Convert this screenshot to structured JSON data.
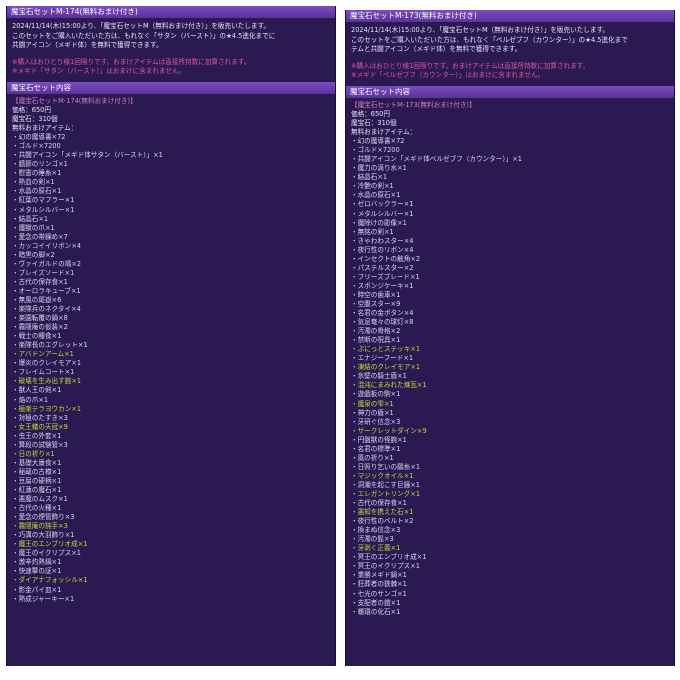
{
  "left": {
    "header1": "魔宝石セットM-174(無料おまけ付き)",
    "notice": [
      "2024/11/14(木)15:00より、「魔宝石セットM（無料おまけ付き）」を販売いたします。",
      "このセットをご購入いただいた方は、もれなく「サタン（バースト）」の★4.5進化までに",
      "共闘アイコン（メギド体）を無料で獲得できます。"
    ],
    "warnings": [
      "※購入はおひとり様1回限りです。おまけアイテムは直接所持数に加算されます。",
      "※メギド「サタン（バースト）」はおまけに含まれません。"
    ],
    "header2": "魔宝石セット内容",
    "set_title": "【魔宝石セットM-174(無料おまけ付き)】",
    "price": "価格：650円",
    "gems": "魔宝石：310個",
    "bonus_label": "無料おまけアイテム：",
    "items": [
      "幻の魔導書×72",
      "ゴルド×7200",
      "共闘アイコン「メギド体サタン（バースト）」×1",
      "膳節のリンゴ×1",
      "慰霊の睡糸×1",
      "熱血の剣×1",
      "水晶の原石×1",
      "紅葉のマフラー×1",
      "メタルシルバー×1",
      "結晶石×1",
      "魔獣の爪×1",
      "愛念の帯錦め×7",
      "カッコイイリボン×4",
      "暗黒の脚×2",
      "ヴァイガルドの鳩×2",
      "ブレイズソード×1",
      "古代の保存食×1",
      "オーロラキューブ×1",
      "無風の尾嶽×6",
      "楽隊兵のネクタイ×4",
      "楽園転覆の鍋×8",
      "霧隠庵の仮装×2",
      "戦士の種食×1",
      "楽隊長のエグレット×1",
      "アバドンアーム×1",
      "爆炎のクレイモア×1",
      "フレイムコート×1",
      "破壊を生み出す腕×1",
      "獣人王の剣×1",
      "焔の爪×1",
      "極楽テラヨウカン×1",
      "対極のたすき×3",
      "女王蟻の天冠×9",
      "虫王の外套×1",
      "算段の試験管×3",
      "日の祈り×1",
      "基礎大康食×1",
      "秘蔵の古樽×1",
      "豆腐の硬柄×1",
      "紅蓮の魔石×1",
      "悪魔のムスク×1",
      "古代の火種×1",
      "愛念の煙管飾り×3",
      "霧隠庵の鈍手×3",
      "巧溝の大羽飾り×1",
      "魔王のエンブリオ成×1",
      "魔王のイクリプス×1",
      "激辛灼熱鍋×1",
      "快速撃の証×1",
      "ダイアナフォッシル×1",
      "影金パイ皿×1",
      "熱成ジャーキー×1"
    ],
    "highlight_indexes": [
      24,
      27,
      30,
      32,
      35,
      43,
      45,
      49
    ]
  },
  "right": {
    "header1": "魔宝石セットM-173(無料おまけ付き)",
    "notice": [
      "2024/11/14(木)15:00より、「魔宝石セットM（無料おまけ付き）」を販売いたします。",
      "このセットをご購入いただいた方は、もれなく「ベルゼブフ（カウンター）」の★4.5進化まで",
      "テムと共闘アイコン（メギド体）を無料で獲得できます。"
    ],
    "warnings": [
      "※購入はおひとり様1回限りです。おまけアイテムは直接所持数に加算されます。",
      "※メギド「ベルゼブフ（カウンター）」はおまけに含まれません。"
    ],
    "header2": "魔宝石セット内容",
    "set_title": "【魔宝石セットM-173(無料おまけ付き)】",
    "price": "価格：650円",
    "gems": "魔宝石：310個",
    "bonus_label": "無料おまけアイテム：",
    "items": [
      "幻の魔導書×72",
      "ゴルド×7200",
      "共闘アイコン「メギド体ベルゼブフ（カウンター）」×1",
      "魔力の滴り水×1",
      "結晶石×1",
      "冷艶の剣×1",
      "水晶の原石×1",
      "ゼロバックラー×1",
      "メタルシルバー×1",
      "魔除けの彫像×1",
      "無銘の剣×1",
      "きゃわわスター×4",
      "夜行性のリボン×4",
      "インセクトの触角×2",
      "パステルスター×2",
      "フリーズブレード×1",
      "スポンジケーキ×1",
      "時空の歯車×1",
      "空腹スター×9",
      "名君の金ボタン×4",
      "気息奄々の球灯×8",
      "汚濁の骨格×2",
      "禁断の呪具×1",
      "ぷにっとステッキ×1",
      "エナジーフード×1",
      "凍結のクレイモア×1",
      "氷壁の騎士盾×1",
      "混沌にまみれた煉瓦×1",
      "遊戯板の駒×1",
      "魔泉の雫×1",
      "神力の盾×1",
      "牙研ぐ信念×3",
      "サークレットダイン×9",
      "円盤獣の怪腕×1",
      "名君の標準×1",
      "風の祈り×1",
      "日照り乞いの願糸×1",
      "マジックオイル×1",
      "洞潮を起こす巨鐘×1",
      "エレガントリング×1",
      "古代の保存食×1",
      "悪知を携えた石×1",
      "夜行性のベルト×2",
      "換まぬ信念×3",
      "汚濁の髭×3",
      "牙剥く正義×1",
      "冥王のエンブリオ成×1",
      "冥王のイクリプス×1",
      "業勝メギド鍋×1",
      "狂葬者の鉄棘×1",
      "七光のサンゴ×1",
      "支配者の鎧×1",
      "螺環の化石×1"
    ],
    "highlight_indexes": [
      23,
      25,
      27,
      29,
      32,
      37,
      39,
      41,
      45
    ]
  }
}
